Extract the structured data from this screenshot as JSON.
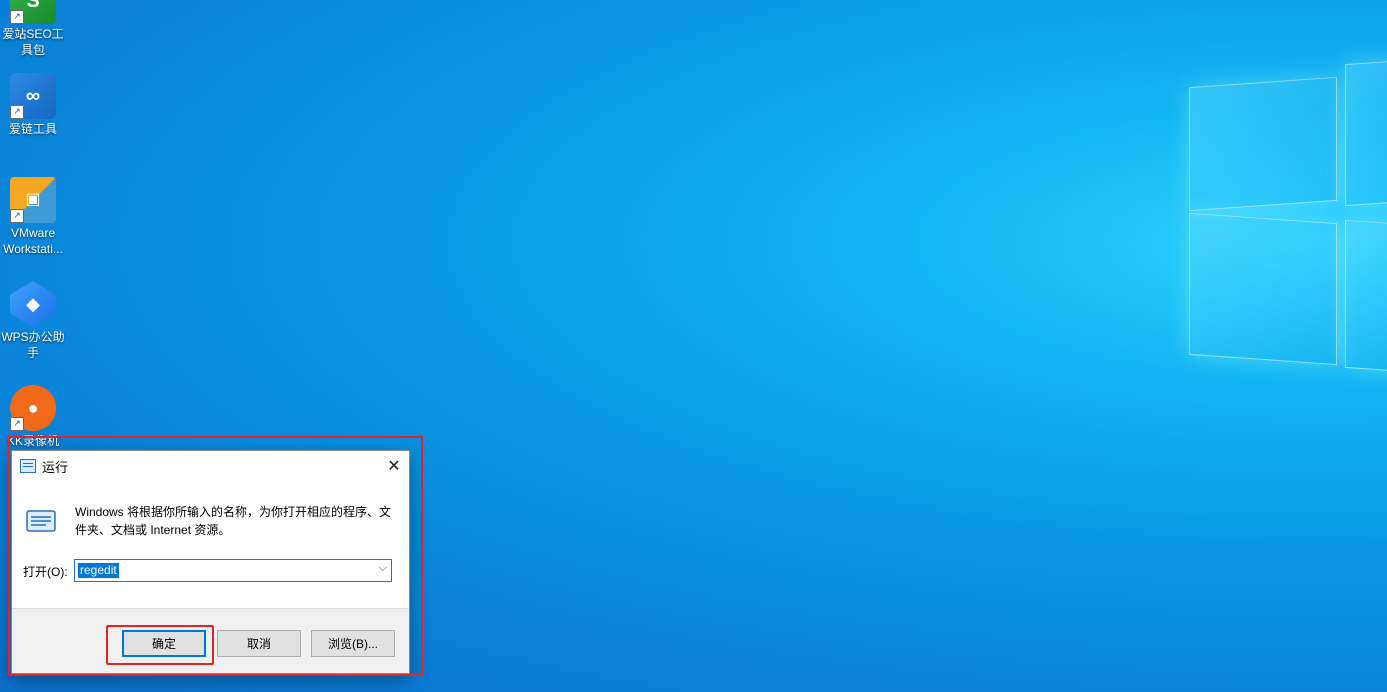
{
  "desktop": {
    "icons": [
      {
        "label": "爱站SEO工具包",
        "icon": "seo-tool-icon"
      },
      {
        "label": "爱链工具",
        "icon": "link-tool-icon"
      },
      {
        "label": "VMware Workstati...",
        "icon": "vmware-icon"
      },
      {
        "label": "WPS办公助手",
        "icon": "wps-icon"
      },
      {
        "label": "KK录像机",
        "icon": "kk-recorder-icon"
      }
    ]
  },
  "run_dialog": {
    "title": "运行",
    "description": "Windows 将根据你所输入的名称，为你打开相应的程序、文件夹、文档或 Internet 资源。",
    "open_label": "打开(O):",
    "input_value": "regedit",
    "buttons": {
      "ok": "确定",
      "cancel": "取消",
      "browse": "浏览(B)..."
    }
  },
  "colors": {
    "highlight": "#e62323",
    "accent": "#0078d7"
  }
}
